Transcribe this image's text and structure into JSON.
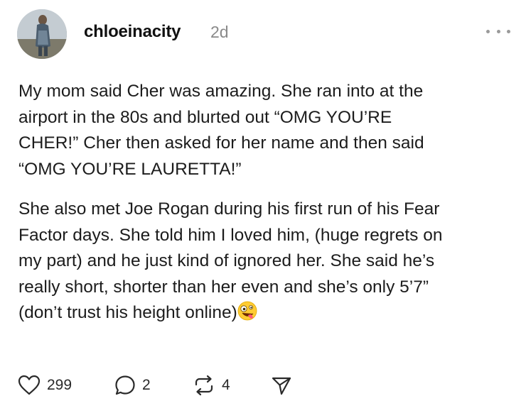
{
  "post": {
    "username": "chloeinacity",
    "timestamp": "2d",
    "paragraphs": [
      "My mom said Cher was amazing. She ran into at the\nairport in the 80s and blurted out “OMG YOU’RE\nCHER!” Cher then asked for her name and then said\n“OMG YOU’RE LAURETTA!”",
      "She also met Joe Rogan during his first run of his Fear\nFactor days. She told him I loved him, (huge regrets on\nmy part) and he just kind of ignored her. She said he’s\nreally short, shorter than her even and she’s only 5’7”\n(don’t trust his height online)"
    ],
    "trailing_emoji": "zany-face-emoji"
  },
  "actions": {
    "likes": "299",
    "replies": "2",
    "reposts": "4"
  },
  "colors": {
    "text": "#1c1c1c",
    "muted": "#8a8a8a",
    "icon": "#2a2a2a"
  }
}
